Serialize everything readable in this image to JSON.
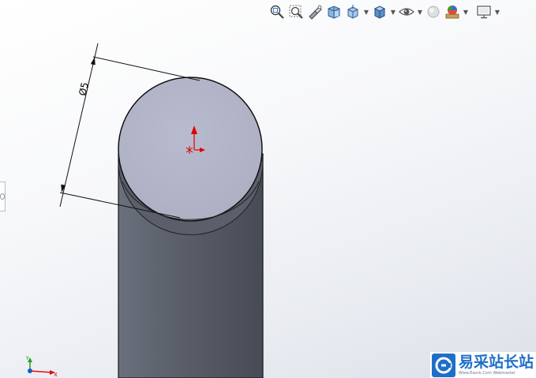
{
  "toolbar": {
    "buttons": [
      {
        "icon": "zoom-to-fit-icon"
      },
      {
        "icon": "zoom-to-area-icon"
      },
      {
        "icon": "previous-view-icon"
      },
      {
        "icon": "section-view-icon"
      },
      {
        "icon": "view-orientation-icon",
        "dropdown": true
      },
      {
        "icon": "display-style-icon",
        "dropdown": true
      },
      {
        "icon": "hide-show-items-icon",
        "dropdown": true
      },
      {
        "icon": "edit-appearance-icon"
      },
      {
        "icon": "apply-scene-icon",
        "dropdown": true
      },
      {
        "icon": "view-settings-icon",
        "dropdown": true
      }
    ]
  },
  "model": {
    "dimension_label": "Ø5",
    "colors": {
      "face_top": "#b3b6c9",
      "cylinder_dark": "#4b505c",
      "cylinder_light": "#6a707c",
      "origin_red": "#e00000"
    }
  },
  "triad": {
    "x_label": "X",
    "y_label": "Y"
  },
  "watermark": {
    "title": "易采站长站",
    "subtitle": "Www.Easck.Com  Webmaster"
  },
  "colors": {
    "accent": "#1f6fc8"
  }
}
